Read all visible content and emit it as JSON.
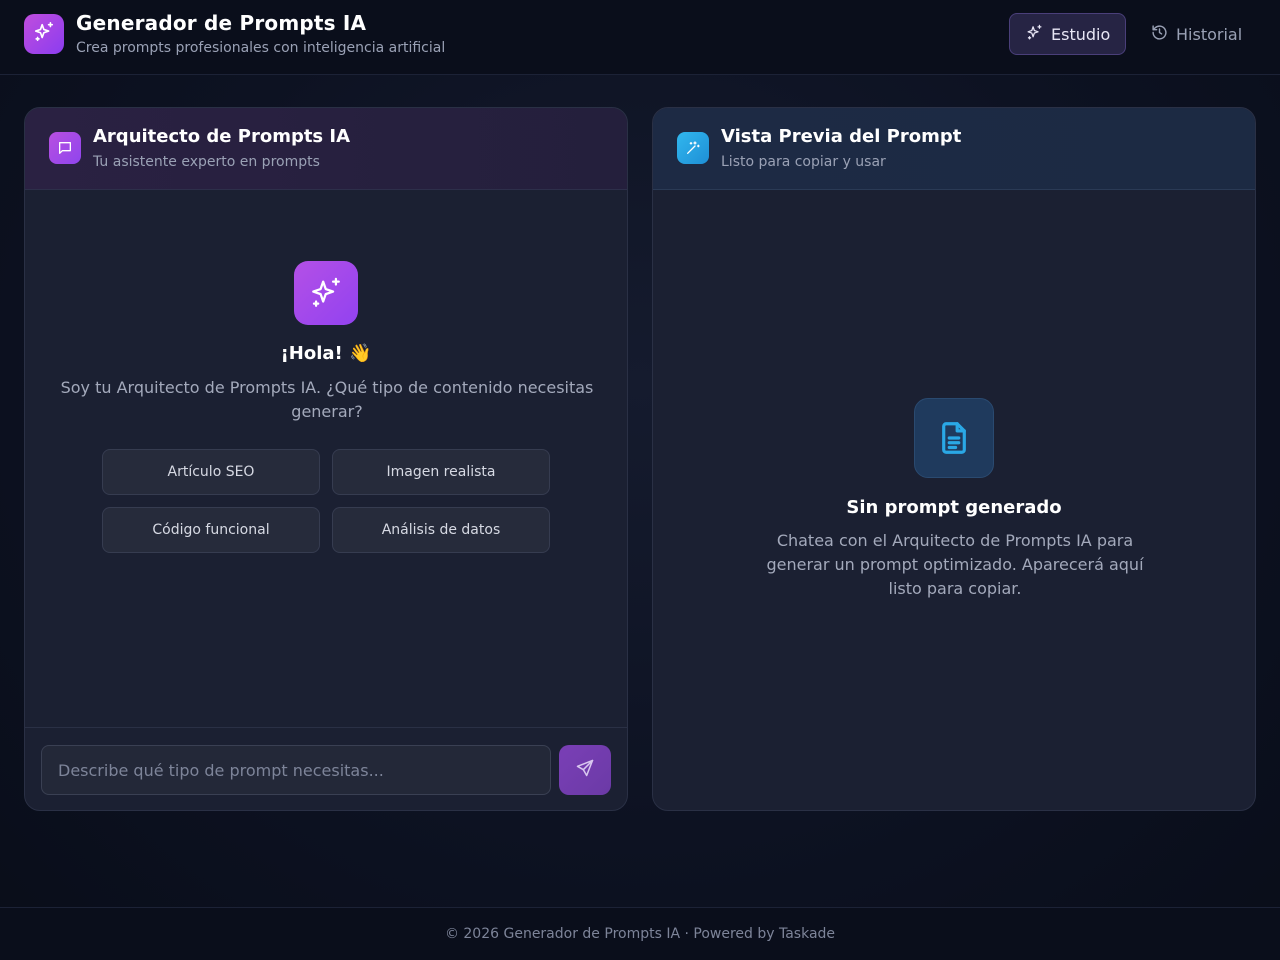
{
  "header": {
    "title": "Generador de Prompts IA",
    "subtitle": "Crea prompts profesionales con inteligencia artificial",
    "logo_icon": "sparkles-icon",
    "nav": [
      {
        "label": "Estudio",
        "icon": "sparkles-icon",
        "active": true
      },
      {
        "label": "Historial",
        "icon": "history-icon",
        "active": false
      }
    ]
  },
  "chat_panel": {
    "title": "Arquitecto de Prompts IA",
    "subtitle": "Tu asistente experto en prompts",
    "icon": "chat-bubble-icon",
    "welcome_icon": "sparkles-icon",
    "welcome_title": "¡Hola! 👋",
    "welcome_text": "Soy tu Arquitecto de Prompts IA. ¿Qué tipo de contenido necesitas generar?",
    "suggestions": [
      "Artículo SEO",
      "Imagen realista",
      "Código funcional",
      "Análisis de datos"
    ],
    "input": {
      "placeholder": "Describe qué tipo de prompt necesitas...",
      "value": ""
    },
    "send_icon": "send-icon"
  },
  "preview_panel": {
    "title": "Vista Previa del Prompt",
    "subtitle": "Listo para copiar y usar",
    "icon": "magic-wand-icon",
    "empty_icon": "document-icon",
    "empty_title": "Sin prompt generado",
    "empty_text": "Chatea con el Arquitecto de Prompts IA para generar un prompt optimizado. Aparecerá aquí listo para copiar."
  },
  "footer": {
    "text": "© 2026 Generador de Prompts IA · Powered by Taskade"
  },
  "colors": {
    "accent_purple": "#a855f7",
    "accent_blue": "#29aee8",
    "background": "#0d1222"
  }
}
